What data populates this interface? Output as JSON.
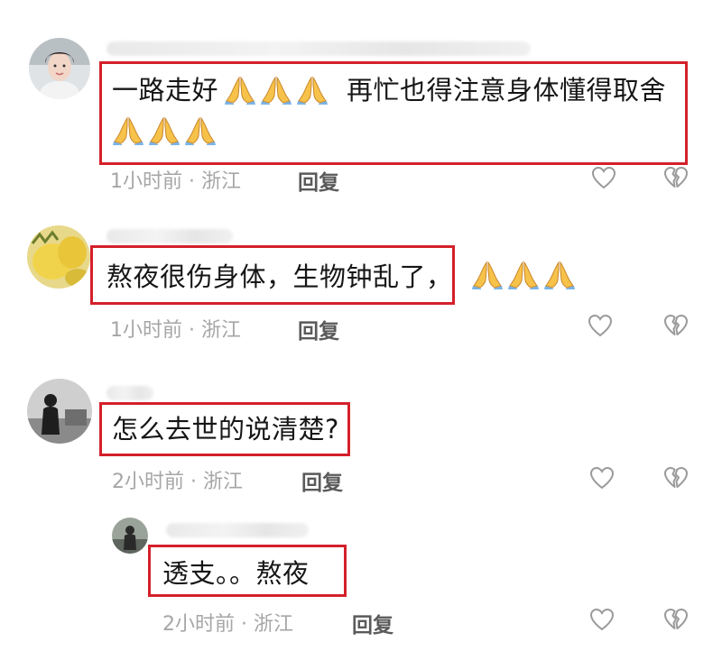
{
  "comments": [
    {
      "text_line1": "一路走好",
      "text_mid": "再忙也得注意身体懂得取舍",
      "time": "1小时前 · 浙江",
      "reply": "回复"
    },
    {
      "text": "熬夜很伤身体，生物钟乱了，",
      "time": "1小时前 · 浙江",
      "reply": "回复"
    },
    {
      "text": "怎么去世的说清楚?",
      "time": "2小时前 · 浙江",
      "reply": "回复"
    },
    {
      "text": "透支。。熬夜",
      "time": "2小时前 · 浙江",
      "reply": "回复"
    }
  ],
  "icons": {
    "like": "heart-outline-icon",
    "dislike": "broken-heart-icon",
    "emoji": "folded-hands-emoji"
  },
  "colors": {
    "highlight": "#d4202a",
    "meta": "#a6a6a6"
  }
}
